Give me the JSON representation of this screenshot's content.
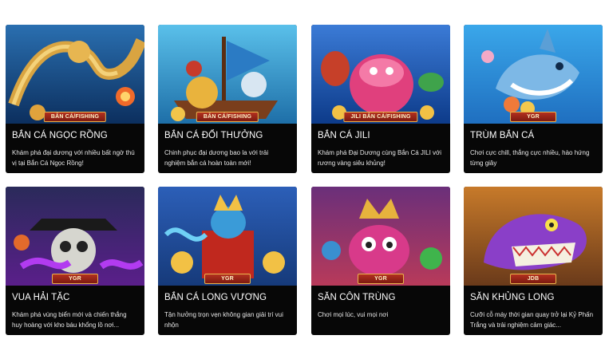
{
  "games": [
    {
      "title": "BẮN CÁ NGỌC RỒNG",
      "badge": "BẮN CÁ/FISHING",
      "description": "Khám phá đại dương với nhiều bất ngờ thú vị tại Bắn Cá Ngọc Rồng!"
    },
    {
      "title": "BẮN CÁ ĐỔI THƯỞNG",
      "badge": "BẮN CÁ/FISHING",
      "description": "Chinh phục đại dương bao la với trải nghiệm bắn cá hoàn toàn mới!"
    },
    {
      "title": "BẮN CÁ JILI",
      "badge": "JILI BẮN CÁ/FISHING",
      "description": "Khám phá Đại Dương cùng Bắn Cá JILI với rương vàng siêu khủng!"
    },
    {
      "title": "TRÙM BẮN CÁ",
      "badge": "YGR",
      "description": "Chơi cực chill, thắng cực nhiều, hào hứng từng giây"
    },
    {
      "title": "VUA HẢI TẶC",
      "badge": "YGR",
      "description": "Khám phá vùng biển mới và chiến thắng huy hoàng với kho báu khổng lồ nơi..."
    },
    {
      "title": "BẮN CÁ LONG VƯƠNG",
      "badge": "YGR",
      "description": "Tận hưởng trọn vẹn không gian giải trí vui nhộn"
    },
    {
      "title": "SĂN CÔN TRÙNG",
      "badge": "YGR",
      "description": "Chơi mọi lúc, vui mọi nơi"
    },
    {
      "title": "SĂN KHỦNG LONG",
      "badge": "JDB",
      "description": "Cưỡi cỗ máy thời gian quay trở lại Kỷ Phấn Trắng và trải nghiệm cảm giác..."
    }
  ]
}
